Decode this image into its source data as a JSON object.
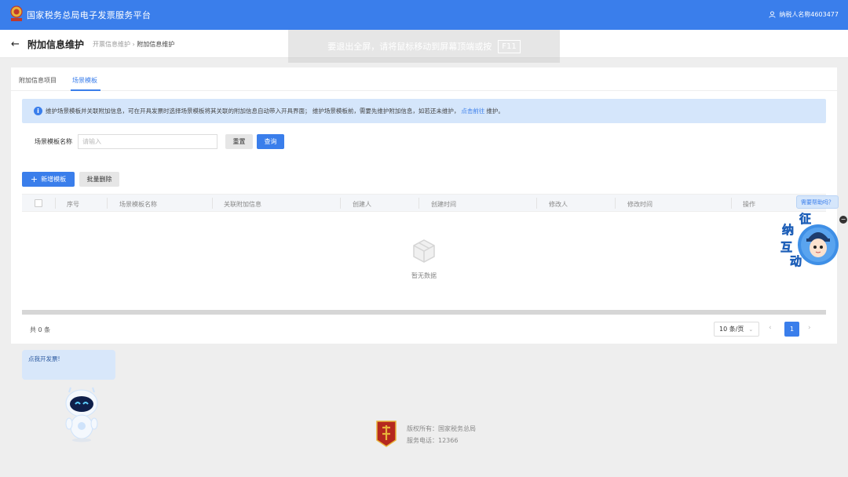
{
  "header": {
    "platform_title": "国家税务总局电子发票服务平台",
    "user_name": "纳税人名称4603477"
  },
  "page": {
    "title": "附加信息维护",
    "breadcrumb": [
      "开票信息维护",
      "附加信息维护"
    ]
  },
  "fullscreen_tip": {
    "text": "要退出全屏，请将鼠标移动到屏幕顶端或按",
    "key": "F11"
  },
  "tabs": [
    {
      "label": "附加信息项目",
      "active": false
    },
    {
      "label": "场景模板",
      "active": true
    }
  ],
  "alert": {
    "text_before": "维护场景模板并关联附加信息，可在开具发票时选择场景模板将其关联的附加信息自动带入开具界面； 维护场景模板前，需要先维护附加信息，如若还未维护，",
    "link": "点击前往",
    "text_after": "维护。"
  },
  "filter": {
    "label": "场景模板名称",
    "placeholder": "请输入",
    "value": "",
    "reset_label": "重置",
    "query_label": "查询"
  },
  "actions": {
    "add_label": "新增模板",
    "batch_delete_label": "批量删除"
  },
  "table": {
    "columns": [
      "序号",
      "场景模板名称",
      "关联附加信息",
      "创建人",
      "创建时间",
      "修改人",
      "修改时间",
      "操作"
    ],
    "rows": [],
    "empty_text": "暂无数据"
  },
  "pagination": {
    "total_text": "共 0 条",
    "page_size": "10 条/页",
    "current_page": "1"
  },
  "assistant": {
    "help_text": "需要帮助吗？",
    "chars": [
      "征",
      "纳",
      "互",
      "动"
    ]
  },
  "invoice_helper": {
    "text": "点我开发票!"
  },
  "footer": {
    "copyright": "版权所有：国家税务总局",
    "tel": "服务电话：12366"
  },
  "colors": {
    "primary": "#3a7eeb",
    "alert_bg": "#d5e6fb",
    "page_bg": "#eeeeee"
  }
}
